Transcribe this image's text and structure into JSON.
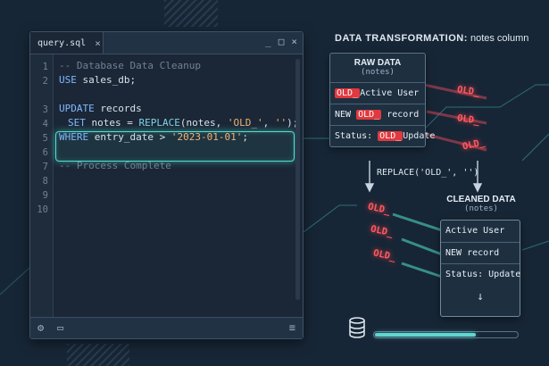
{
  "editor": {
    "tab_label": "query.sql",
    "tab_close": "×",
    "controls": [
      "_",
      "□",
      "×"
    ],
    "line_numbers": [
      "1",
      "2",
      "3",
      "4",
      "5",
      "6",
      "7",
      "8",
      "9",
      "10"
    ],
    "active_line": "3",
    "lines": {
      "l1": "-- Database Data Cleanup",
      "l2_kw": "USE",
      "l2_rest": " sales_db;",
      "l3_kw": "UPDATE",
      "l3_rest": " records",
      "l4_kw": "SET",
      "l4_a": " notes = ",
      "l4_fn": "REPLACE",
      "l4_b": "(notes, ",
      "l4_str1": "'OLD_'",
      "l4_c": ", ",
      "l4_str2": "''",
      "l4_d": ");",
      "l5_kw": "WHERE",
      "l5_a": " entry_date > ",
      "l5_str": "'2023-01-01'",
      "l5_b": ";",
      "l7": "-- Process Complete"
    }
  },
  "panel": {
    "title_bold": "DATA TRANSFORMATION:",
    "title_rest": " notes column",
    "raw": {
      "title": "RAW DATA",
      "subtitle": "(notes)",
      "rows": [
        {
          "pre": "",
          "token": "OLD_",
          "post": "Active User"
        },
        {
          "pre": "NEW ",
          "token": "OLD_",
          "post": " record"
        },
        {
          "pre": "Status: ",
          "token": "OLD_",
          "post": "Update"
        }
      ]
    },
    "replace_label": "REPLACE('OLD_', '')",
    "cleaned": {
      "title": "CLEANED DATA",
      "subtitle": "(notes)",
      "rows": [
        "Active User",
        "NEW record",
        "Status: Update"
      ],
      "arrow": "↓"
    },
    "floating_tokens": [
      "OLD_",
      "OLD_",
      "OLD_",
      "OLD_",
      "OLD_",
      "OLD_"
    ],
    "progress": 0.7
  },
  "colors": {
    "accent": "#4ee0d0",
    "token": "#e0393f",
    "glow": "#ff5a5e"
  }
}
